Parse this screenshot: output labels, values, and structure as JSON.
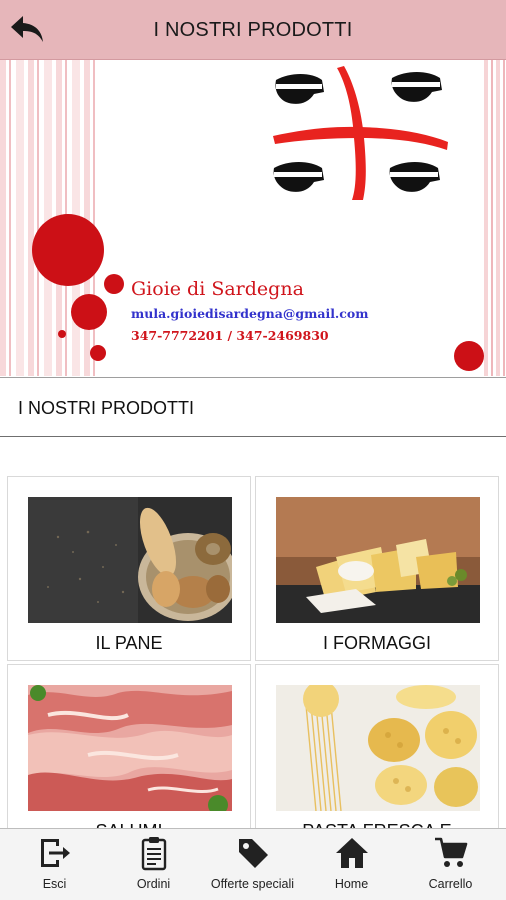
{
  "header": {
    "title": "I NOSTRI PRODOTTI",
    "back_icon": "back-arrow-icon"
  },
  "banner": {
    "brand_name": "Gioie di Sardegna",
    "email": "mula.gioiedisardegna@gmail.com",
    "phones": "347-7772201 /  347-2469830",
    "accent_color": "#d0151c"
  },
  "section": {
    "title": "I NOSTRI PRODOTTI"
  },
  "products": [
    {
      "label": "IL PANE"
    },
    {
      "label": "I FORMAGGI"
    },
    {
      "label": "SALUMI"
    },
    {
      "label": "PASTA FRESCA E"
    }
  ],
  "tabbar": {
    "items": [
      {
        "label": "Esci",
        "icon": "exit-icon"
      },
      {
        "label": "Ordini",
        "icon": "clipboard-icon"
      },
      {
        "label": "Offerte speciali",
        "icon": "tag-icon"
      },
      {
        "label": "Home",
        "icon": "home-icon"
      },
      {
        "label": "Carrello",
        "icon": "cart-icon"
      }
    ]
  },
  "colors": {
    "header_bg": "#e6b6ba",
    "brand_red": "#d0151c",
    "email_blue": "#3333cc"
  }
}
